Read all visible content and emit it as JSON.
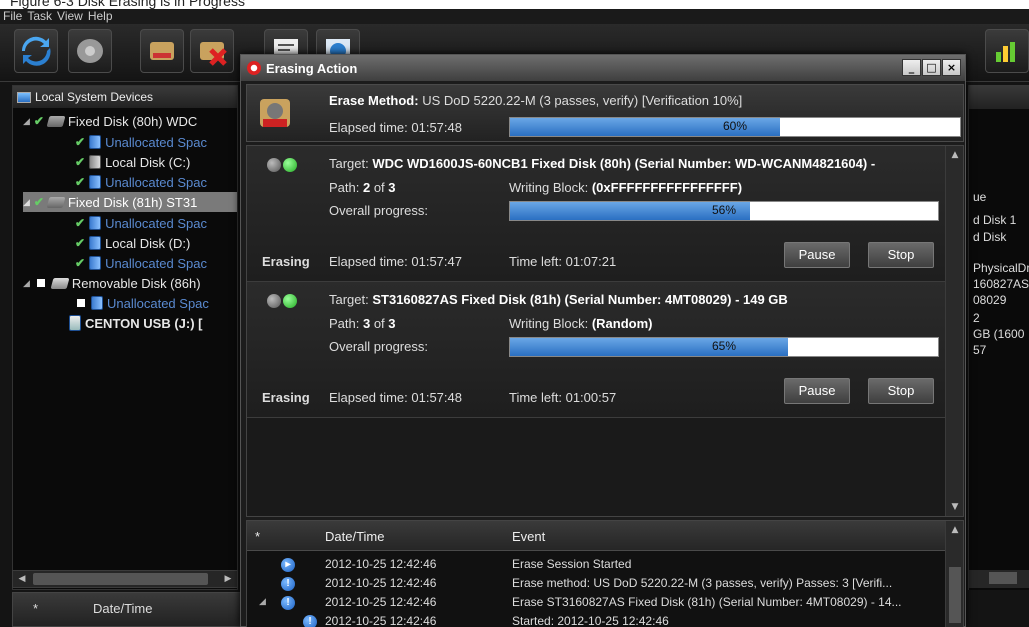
{
  "caption": "Figure 6-3 Disk Erasing is in Progress",
  "menu": [
    "File",
    "Task",
    "View",
    "Help"
  ],
  "left_panel": {
    "header": "Local System Devices",
    "items": [
      {
        "label": "Fixed Disk (80h) WDC",
        "kind": "disk"
      },
      {
        "label": "Unallocated Spac",
        "kind": "unallocated"
      },
      {
        "label": "Local Disk (C:)",
        "kind": "volume"
      },
      {
        "label": "Unallocated Spac",
        "kind": "unallocated"
      },
      {
        "label": "Fixed Disk (81h) ST31",
        "kind": "disk"
      },
      {
        "label": "Unallocated Spac",
        "kind": "unallocated"
      },
      {
        "label": "Local Disk (D:)",
        "kind": "volume"
      },
      {
        "label": "Unallocated Spac",
        "kind": "unallocated"
      },
      {
        "label": "Removable Disk (86h)",
        "kind": "disk"
      },
      {
        "label": "Unallocated Spac",
        "kind": "unallocated"
      },
      {
        "label": "CENTON USB (J:) [",
        "kind": "usb"
      }
    ],
    "selected_index": 4
  },
  "bottom_left": {
    "star": "*",
    "date_col": "Date/Time"
  },
  "right_panel": {
    "lines": [
      "ue",
      "d Disk 1",
      "d Disk",
      "",
      "PhysicalDr",
      "160827AS",
      "08029",
      "2",
      "GB (1600",
      "57"
    ]
  },
  "dialog": {
    "title": "Erasing Action",
    "controls": {
      "minimize": "_",
      "maximize": "□",
      "close": "×"
    },
    "method_label": "Erase Method:",
    "method_value": "US DoD 5220.22-M (3 passes, verify) [Verification 10%]",
    "elapsed": "Elapsed time: 01:57:48",
    "overall_progress": 0.6,
    "overall_progress_text": "60%",
    "targets": [
      {
        "target_prefix": "Target: ",
        "target": "WDC WD1600JS-60NCB1 Fixed Disk (80h) (Serial Number: WD-WCANM4821604) -",
        "path_prefix": "Path: ",
        "path_num": "2",
        "path_of": " of ",
        "path_total": "3",
        "writing_label": "Writing Block: ",
        "writing_value": "(0xFFFFFFFFFFFFFFFF)",
        "overall_label": "Overall progress:",
        "progress": 0.56,
        "progress_text": "56%",
        "status": "Erasing",
        "elapsed": "Elapsed time: 01:57:47",
        "time_left": "Time left: 01:07:21",
        "pause": "Pause",
        "stop": "Stop"
      },
      {
        "target_prefix": "Target: ",
        "target": "ST3160827AS Fixed Disk (81h) (Serial Number: 4MT08029) - 149 GB",
        "path_prefix": "Path: ",
        "path_num": "3",
        "path_of": " of ",
        "path_total": "3",
        "writing_label": "Writing Block: ",
        "writing_value": "(Random)",
        "overall_label": "Overall progress:",
        "progress": 0.65,
        "progress_text": "65%",
        "status": "Erasing",
        "elapsed": "Elapsed time: 01:57:48",
        "time_left": "Time left: 01:00:57",
        "pause": "Pause",
        "stop": "Stop"
      }
    ],
    "events": {
      "columns": [
        "*",
        "Date/Time",
        "Event"
      ],
      "rows": [
        {
          "time": "2012-10-25 12:42:46",
          "event": "Erase Session Started",
          "icon": "start-icon"
        },
        {
          "time": "2012-10-25 12:42:46",
          "event": "Erase method: US DoD 5220.22-M (3 passes, verify) Passes: 3 [Verifi...",
          "icon": "info-icon"
        },
        {
          "time": "2012-10-25 12:42:46",
          "event": "Erase ST3160827AS Fixed Disk (81h) (Serial Number: 4MT08029) - 14...",
          "icon": "info-icon"
        },
        {
          "time": "2012-10-25 12:42:46",
          "event": "Started: 2012-10-25 12:42:46",
          "icon": "info-icon"
        }
      ]
    }
  },
  "colors": {
    "progress_fill": "#2a6fc2",
    "unallocated_text": "#5a8ad0",
    "led_green": "#2a2"
  }
}
